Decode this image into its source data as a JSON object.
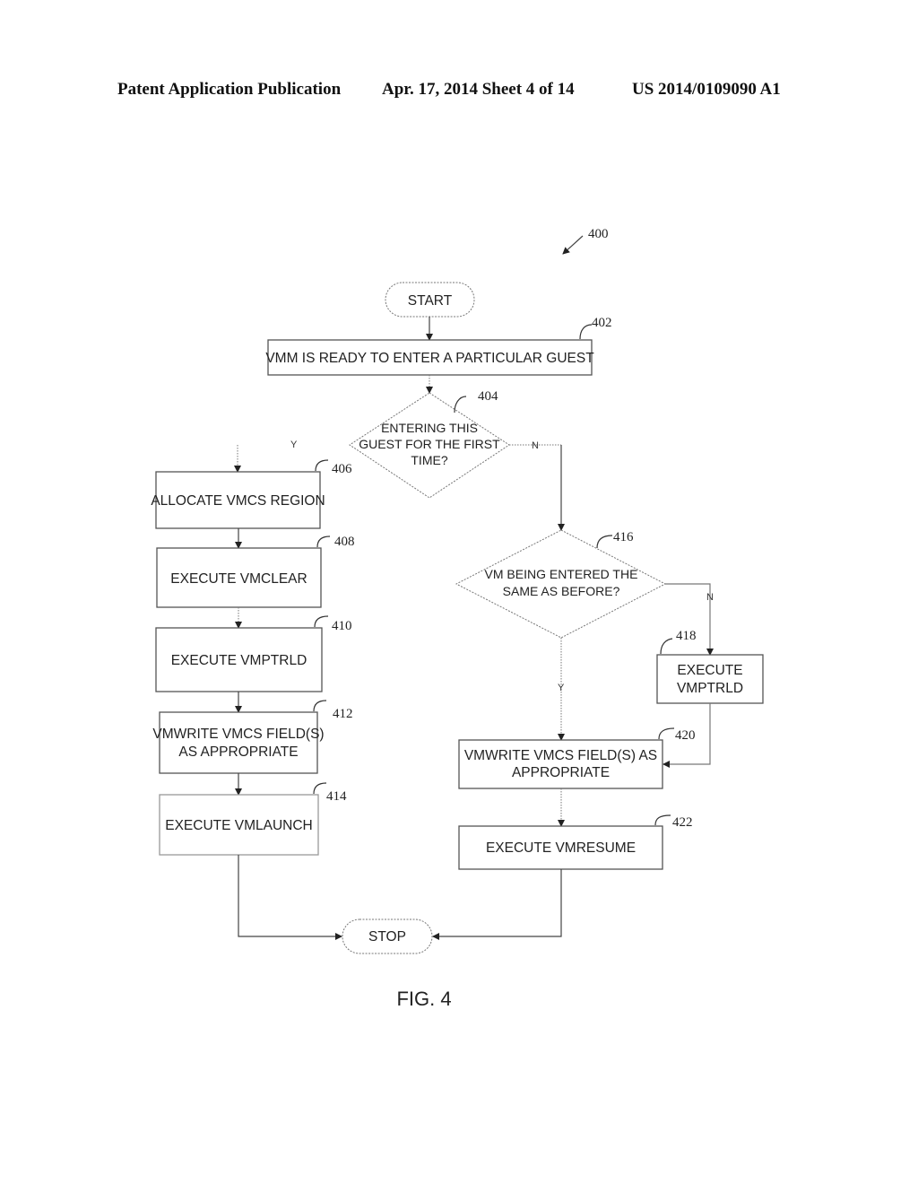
{
  "header": {
    "publication": "Patent Application Publication",
    "date_sheet": "Apr. 17, 2014  Sheet 4 of 14",
    "number": "US 2014/0109090 A1"
  },
  "figure": {
    "ref": "400",
    "caption": "FIG. 4",
    "start": "START",
    "stop": "STOP",
    "nodes": {
      "n402": {
        "ref": "402",
        "lines": [
          "VMM IS READY TO ENTER A PARTICULAR GUEST"
        ]
      },
      "n404": {
        "ref": "404",
        "lines": [
          "ENTERING THIS",
          "GUEST FOR THE FIRST",
          "TIME?"
        ]
      },
      "n406": {
        "ref": "406",
        "lines": [
          "ALLOCATE VMCS REGION"
        ]
      },
      "n408": {
        "ref": "408",
        "lines": [
          "EXECUTE VMCLEAR"
        ]
      },
      "n410": {
        "ref": "410",
        "lines": [
          "EXECUTE VMPTRLD"
        ]
      },
      "n412": {
        "ref": "412",
        "lines": [
          "VMWRITE VMCS FIELD(S)",
          "AS APPROPRIATE"
        ]
      },
      "n414": {
        "ref": "414",
        "lines": [
          "EXECUTE VMLAUNCH"
        ]
      },
      "n416": {
        "ref": "416",
        "lines": [
          "VM BEING ENTERED THE",
          "SAME AS BEFORE?"
        ]
      },
      "n418": {
        "ref": "418",
        "lines": [
          "EXECUTE",
          "VMPTRLD"
        ]
      },
      "n420": {
        "ref": "420",
        "lines": [
          "VMWRITE VMCS FIELD(S) AS",
          "APPROPRIATE"
        ]
      },
      "n422": {
        "ref": "422",
        "lines": [
          "EXECUTE VMRESUME"
        ]
      }
    },
    "branch_labels": {
      "yes": "Y",
      "no": "N"
    }
  }
}
